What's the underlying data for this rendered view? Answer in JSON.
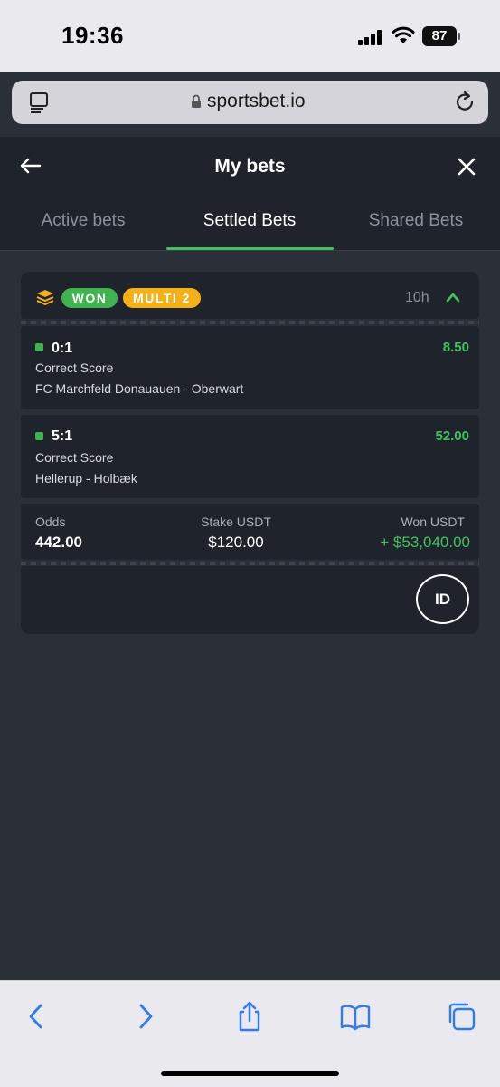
{
  "status_bar": {
    "time": "19:36",
    "battery": "87"
  },
  "browser": {
    "url": "sportsbet.io"
  },
  "header": {
    "title": "My bets",
    "tabs": [
      {
        "label": "Active bets",
        "active": false
      },
      {
        "label": "Settled Bets",
        "active": true
      },
      {
        "label": "Shared Bets",
        "active": false
      }
    ]
  },
  "bet": {
    "status": "WON",
    "type": "MULTI 2",
    "time_ago": "10h",
    "legs": [
      {
        "score": "0:1",
        "odds": "8.50",
        "market": "Correct Score",
        "event": "FC Marchfeld Donauauen - Oberwart"
      },
      {
        "score": "5:1",
        "odds": "52.00",
        "market": "Correct Score",
        "event": "Hellerup - Holbæk"
      }
    ],
    "summary": {
      "odds_label": "Odds",
      "odds_value": "442.00",
      "stake_label": "Stake USDT",
      "stake_value": "$120.00",
      "won_label": "Won USDT",
      "won_value": "+ $53,040.00"
    },
    "id_button": "ID"
  },
  "colors": {
    "accent_green": "#3fc35a",
    "won_badge": "#3fb34f",
    "multi_badge": "#f4b017",
    "panel": "#1f242c",
    "background": "#2b3038"
  }
}
